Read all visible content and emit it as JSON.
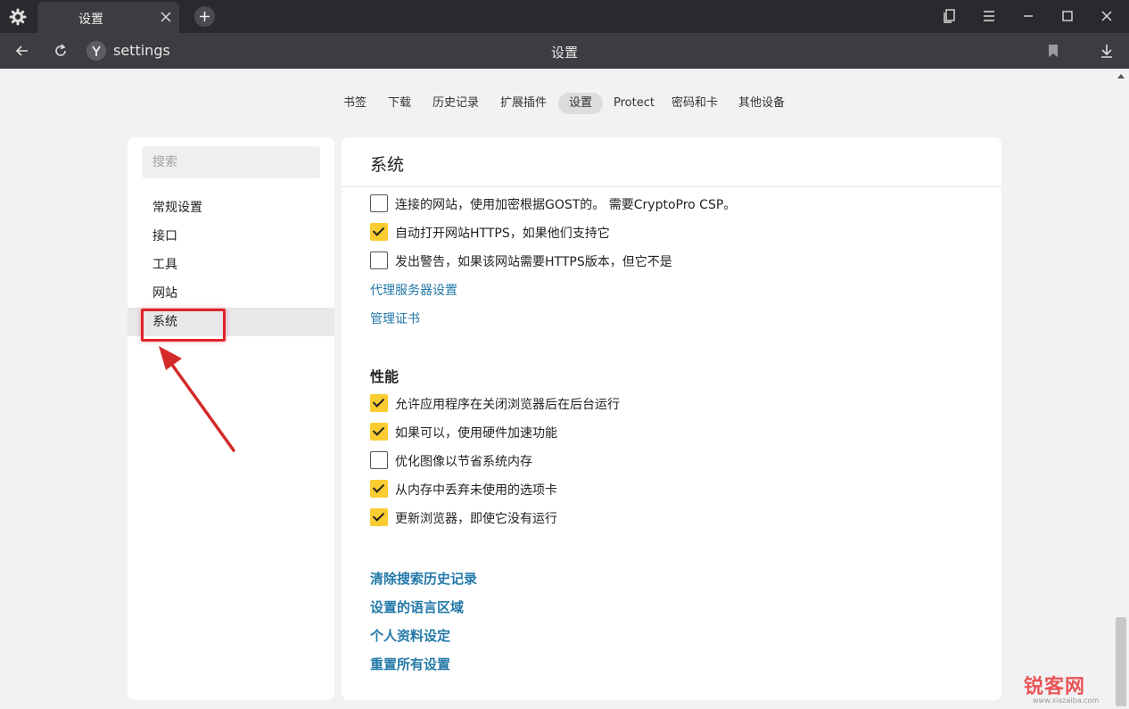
{
  "browser": {
    "tab_title": "设置",
    "url": "settings",
    "page_title": "设置"
  },
  "settings_nav": [
    {
      "label": "书签",
      "active": false
    },
    {
      "label": "下载",
      "active": false
    },
    {
      "label": "历史记录",
      "active": false
    },
    {
      "label": "扩展插件",
      "active": false
    },
    {
      "label": "设置",
      "active": true
    },
    {
      "label": "Protect",
      "active": false
    },
    {
      "label": "密码和卡",
      "active": false
    },
    {
      "label": "其他设备",
      "active": false
    }
  ],
  "sidebar": {
    "search_placeholder": "搜索",
    "items": [
      {
        "label": "常规设置",
        "active": false
      },
      {
        "label": "接口",
        "active": false
      },
      {
        "label": "工具",
        "active": false
      },
      {
        "label": "网站",
        "active": false
      },
      {
        "label": "系统",
        "active": true
      }
    ]
  },
  "main": {
    "title": "系统",
    "network_options": [
      {
        "label": "连接的网站，使用加密根据GOST的。 需要CryptoPro CSP。",
        "checked": false
      },
      {
        "label": "自动打开网站HTTPS，如果他们支持它",
        "checked": true
      },
      {
        "label": "发出警告，如果该网站需要HTTPS版本，但它不是",
        "checked": false
      }
    ],
    "network_links": [
      "代理服务器设置",
      "管理证书"
    ],
    "performance": {
      "title": "性能",
      "options": [
        {
          "label": "允许应用程序在关闭浏览器后在后台运行",
          "checked": true
        },
        {
          "label": "如果可以，使用硬件加速功能",
          "checked": true
        },
        {
          "label": "优化图像以节省系统内存",
          "checked": false
        },
        {
          "label": "从内存中丢弃未使用的选项卡",
          "checked": true
        },
        {
          "label": "更新浏览器，即使它没有运行",
          "checked": true
        }
      ]
    },
    "bottom_links": [
      "清除搜索历史记录",
      "设置的语言区域",
      "个人资料设定",
      "重置所有设置"
    ]
  },
  "watermark": {
    "text": "锐客网",
    "sub": "www.xiazaiba.com"
  },
  "colors": {
    "accent": "#f9cc30",
    "link": "#2379a8",
    "annotation": "#e0232b"
  }
}
